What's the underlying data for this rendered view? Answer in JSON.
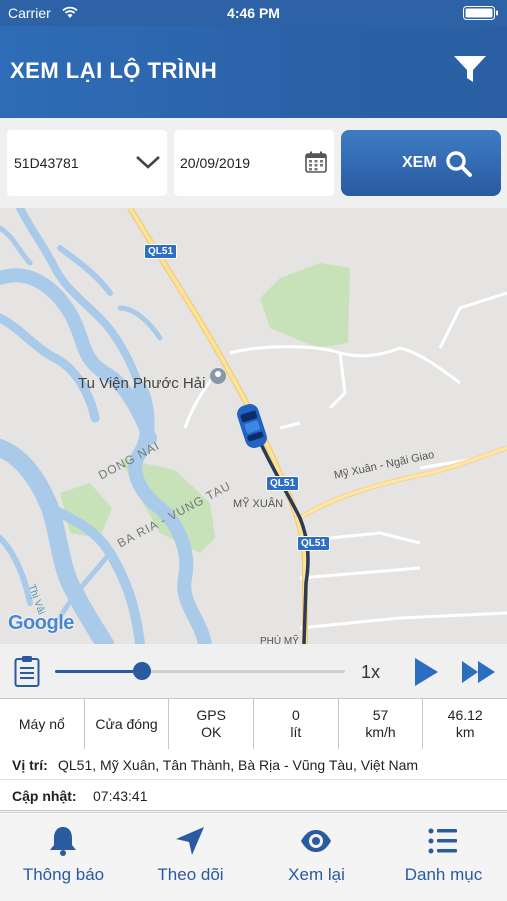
{
  "status_bar": {
    "carrier": "Carrier",
    "time": "4:46 PM"
  },
  "header": {
    "title": "XEM LẠI LỘ TRÌNH",
    "filter_icon": "filter-icon"
  },
  "controls": {
    "vehicle_plate": "51D43781",
    "date": "20/09/2019",
    "view_button_label": "XEM"
  },
  "map": {
    "poi_label": "Tu Viện Phước Hải",
    "province_dong_nai": "DONG NAI",
    "province_ba_ria": "BA RIA - VUNG TAU",
    "place_my_xuan": "MỸ XUÂN",
    "road_my_xuan_ngai_giao": "Mỹ Xuân - Ngãi Giao",
    "river_thi_vai": "Thị Vải",
    "place_phu_my": "PHÚ MỸ",
    "highway_shield_1": "QL51",
    "highway_shield_2": "QL51",
    "highway_shield_3": "QL51",
    "google_logo": "Google"
  },
  "player": {
    "speed": "1x",
    "progress": 0.3
  },
  "stats": [
    {
      "line1": "Máy nổ",
      "line2": ""
    },
    {
      "line1": "Cửa đóng",
      "line2": ""
    },
    {
      "line1": "GPS",
      "line2": "OK"
    },
    {
      "line1": "0",
      "line2": "lít"
    },
    {
      "line1": "57",
      "line2": "km/h"
    },
    {
      "line1": "46.12",
      "line2": "km"
    }
  ],
  "info": {
    "location_label": "Vị trí:",
    "location_value": "QL51, Mỹ Xuân, Tân Thành, Bà Rịa - Vũng Tàu, Việt Nam",
    "updated_label": "Cập nhật:",
    "updated_value": "07:43:41"
  },
  "tabs": [
    {
      "label": "Thông báo",
      "icon": "bell-icon"
    },
    {
      "label": "Theo dõi",
      "icon": "navigation-arrow-icon"
    },
    {
      "label": "Xem lại",
      "icon": "eye-icon"
    },
    {
      "label": "Danh mục",
      "icon": "list-icon"
    }
  ],
  "colors": {
    "primary": "#2a5aa0",
    "header": "#2f6cb7",
    "route": "#2b3a55"
  }
}
